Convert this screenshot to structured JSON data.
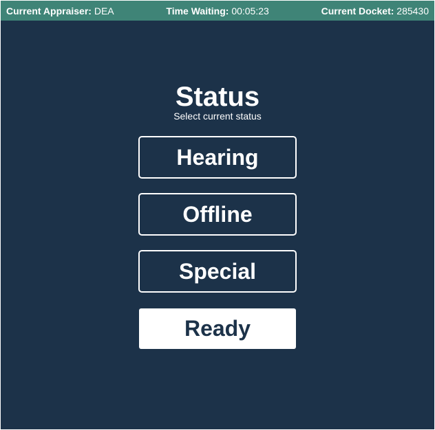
{
  "header": {
    "appraiser_label": "Current Appraiser:",
    "appraiser_value": "DEA",
    "waiting_label": "Time Waiting:",
    "waiting_value": "00:05:23",
    "docket_label": "Current Docket:",
    "docket_value": "285430"
  },
  "main": {
    "title": "Status",
    "subtitle": "Select current status",
    "buttons": [
      {
        "label": "Hearing",
        "selected": false
      },
      {
        "label": "Offline",
        "selected": false
      },
      {
        "label": "Special",
        "selected": false
      },
      {
        "label": "Ready",
        "selected": true
      }
    ]
  },
  "colors": {
    "background": "#1c3249",
    "header": "#3f8477",
    "text": "#ffffff",
    "selected_fill": "#ffffff"
  }
}
